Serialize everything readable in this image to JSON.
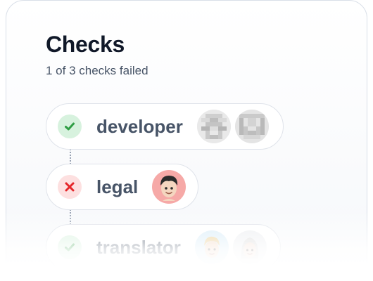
{
  "header": {
    "title": "Checks",
    "subtitle": "1 of 3 checks failed"
  },
  "checks": [
    {
      "label": "developer",
      "status": "passed",
      "status_icon": "check-icon",
      "avatars": [
        "pixelated-avatar-icon",
        "pixelated-avatar-icon"
      ]
    },
    {
      "label": "legal",
      "status": "failed",
      "status_icon": "x-icon",
      "avatars": [
        "memoji-avatar-icon"
      ]
    },
    {
      "label": "translator",
      "status": "passed",
      "status_icon": "check-icon",
      "avatars": [
        "memoji-avatar-icon",
        "memoji-avatar-icon"
      ]
    }
  ],
  "colors": {
    "passed": "#2f9e44",
    "failed": "#e5262a",
    "passed_bg": "#d7f2de",
    "failed_bg": "#fde0e0"
  }
}
